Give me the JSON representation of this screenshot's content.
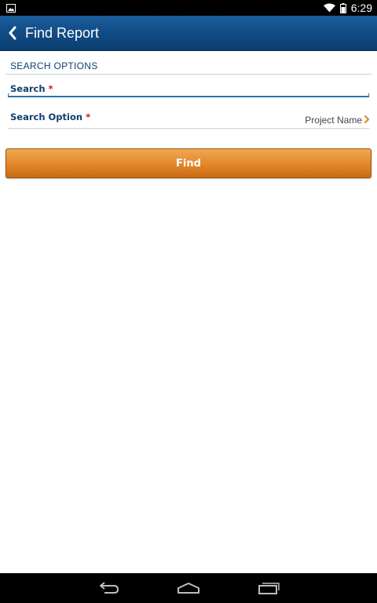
{
  "status_bar": {
    "time": "6:29",
    "icons": [
      "image-notification-icon",
      "wifi-icon",
      "battery-icon"
    ]
  },
  "action_bar": {
    "title": "Find Report",
    "back_icon": "chevron-left-icon",
    "background_color": "#124d86"
  },
  "form": {
    "section_header": "SEARCH OPTIONS",
    "search_label": "Search",
    "search_required_mark": "*",
    "search_value": "",
    "search_option_label": "Search Option",
    "search_option_required_mark": "*",
    "search_option_value": "Project Name",
    "required_color": "#d0141c"
  },
  "find_button": {
    "label": "Find",
    "color": "#e38a2c"
  },
  "nav_bar": {
    "icons": [
      "back-icon",
      "home-icon",
      "recent-apps-icon"
    ]
  }
}
